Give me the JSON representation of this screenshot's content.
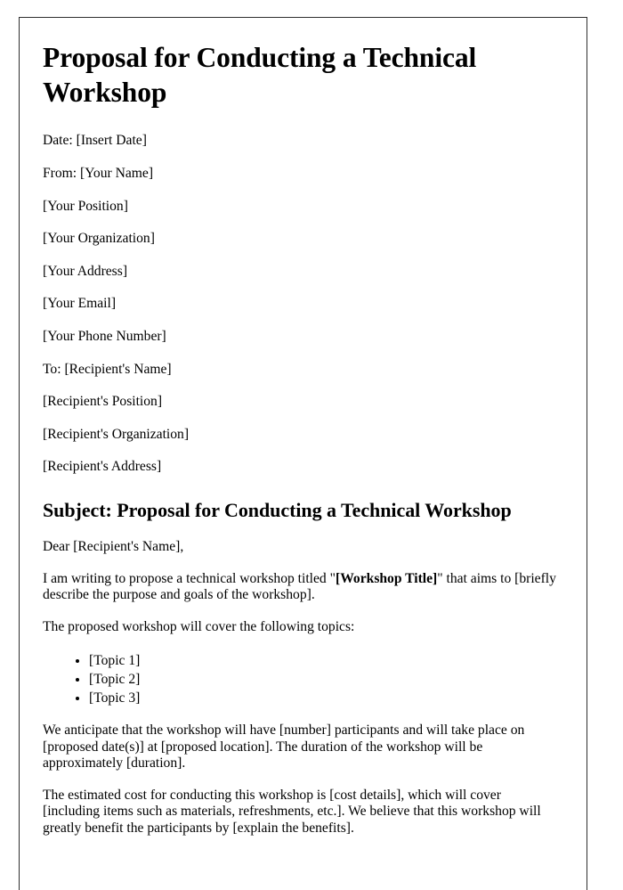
{
  "document": {
    "title": "Proposal for Conducting a Technical Workshop",
    "sender_block": [
      "Date: [Insert Date]",
      "From: [Your Name]",
      "[Your Position]",
      "[Your Organization]",
      "[Your Address]",
      "[Your Email]",
      "[Your Phone Number]"
    ],
    "recipient_block": [
      "To: [Recipient's Name]",
      "[Recipient's Position]",
      "[Recipient's Organization]",
      "[Recipient's Address]"
    ],
    "subject_heading": "Subject: Proposal for Conducting a Technical Workshop",
    "salutation": "Dear [Recipient's Name],",
    "intro_paragraph": {
      "before_bold": "I am writing to propose a technical workshop titled \"",
      "bold": "[Workshop Title]",
      "after_bold": "\" that aims to [briefly describe the purpose and goals of the workshop]."
    },
    "topics_lead_in": "The proposed workshop will cover the following topics:",
    "topics": [
      "[Topic 1]",
      "[Topic 2]",
      "[Topic 3]"
    ],
    "logistics_paragraph": "We anticipate that the workshop will have [number] participants and will take place on [proposed date(s)] at [proposed location]. The duration of the workshop will be approximately [duration].",
    "cost_paragraph": "The estimated cost for conducting this workshop is [cost details], which will cover [including items such as materials, refreshments, etc.]. We believe that this workshop will greatly benefit the participants by [explain the benefits]."
  },
  "colors": {
    "page_background": "#ffffff",
    "page_border": "#2f2f2f",
    "text": "#000000"
  }
}
